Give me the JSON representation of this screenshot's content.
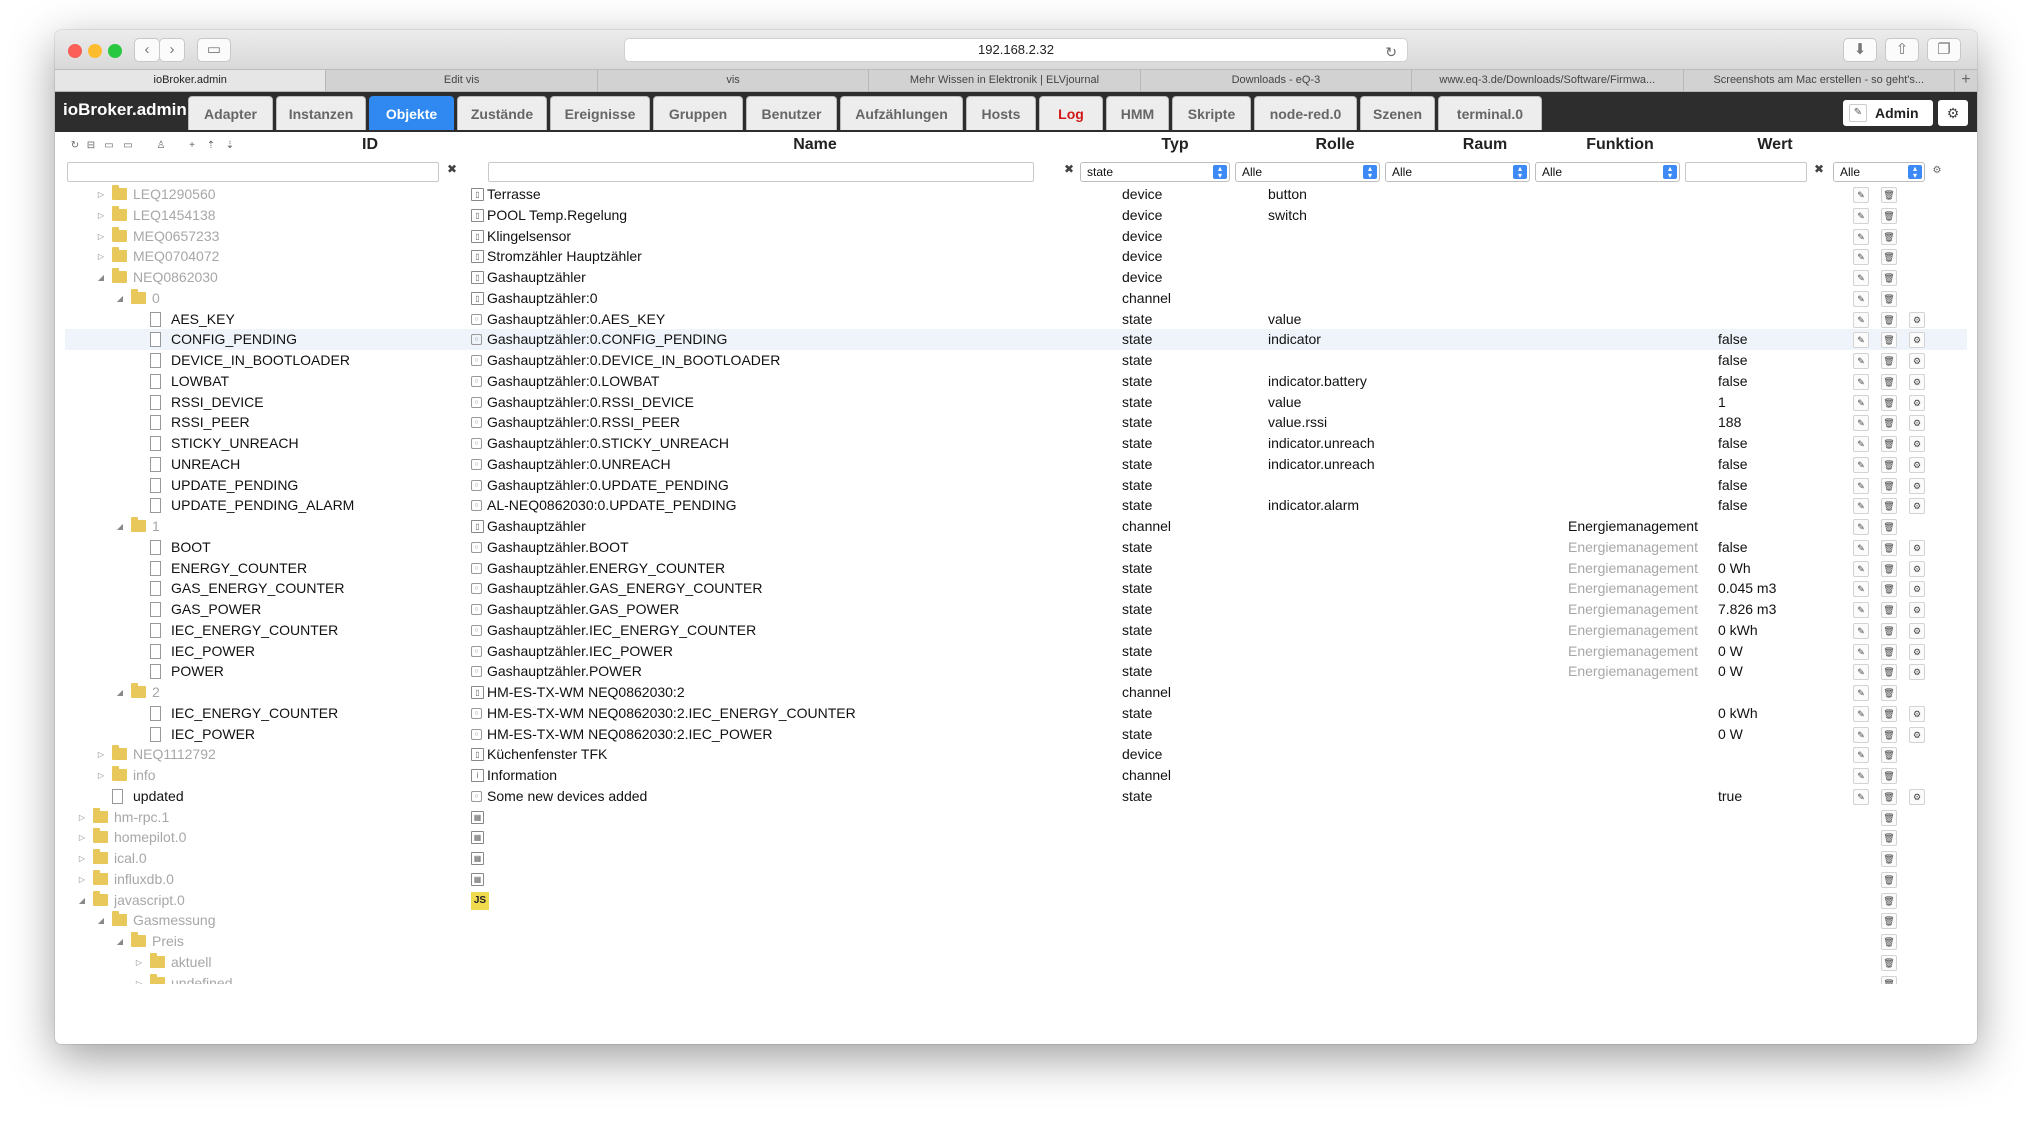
{
  "browser": {
    "address": "192.168.2.32",
    "tabs": [
      "ioBroker.admin",
      "Edit vis",
      "vis",
      "Mehr Wissen in Elektronik | ELVjournal",
      "Downloads - eQ-3",
      "www.eq-3.de/Downloads/Software/Firmwa...",
      "Screenshots am Mac erstellen - so geht's..."
    ]
  },
  "app": {
    "brand": "ioBroker.admin",
    "nav": [
      "Adapter",
      "Instanzen",
      "Objekte",
      "Zustände",
      "Ereignisse",
      "Gruppen",
      "Benutzer",
      "Aufzählungen",
      "Hosts",
      "Log",
      "HMM",
      "Skripte",
      "node-red.0",
      "Szenen",
      "terminal.0"
    ],
    "active_tab": "Objekte",
    "user": "Admin"
  },
  "table": {
    "headers": {
      "id": "ID",
      "name": "Name",
      "typ": "Typ",
      "rolle": "Rolle",
      "raum": "Raum",
      "funktion": "Funktion",
      "wert": "Wert"
    },
    "filters": {
      "typ": "state",
      "rolle": "Alle",
      "raum": "Alle",
      "funktion": "Alle",
      "last": "Alle"
    },
    "rows": [
      {
        "id": "LEQ1290560",
        "name": "Terrasse",
        "typ": "device",
        "rolle": "button",
        "funktion": "",
        "wert": ""
      },
      {
        "id": "LEQ1454138",
        "name": "POOL Temp.Regelung",
        "typ": "device",
        "rolle": "switch",
        "funktion": "",
        "wert": ""
      },
      {
        "id": "MEQ0657233",
        "name": "Klingelsensor",
        "typ": "device",
        "rolle": "",
        "funktion": "",
        "wert": ""
      },
      {
        "id": "MEQ0704072",
        "name": "Stromzähler Hauptzähler",
        "typ": "device",
        "rolle": "",
        "funktion": "",
        "wert": ""
      },
      {
        "id": "NEQ0862030",
        "name": "Gashauptzähler",
        "typ": "device",
        "rolle": "",
        "funktion": "",
        "wert": ""
      },
      {
        "id": "0",
        "name": "Gashauptzähler:0",
        "typ": "channel",
        "rolle": "",
        "funktion": "",
        "wert": ""
      },
      {
        "id": "AES_KEY",
        "name": "Gashauptzähler:0.AES_KEY",
        "typ": "state",
        "rolle": "value",
        "funktion": "",
        "wert": ""
      },
      {
        "id": "CONFIG_PENDING",
        "name": "Gashauptzähler:0.CONFIG_PENDING",
        "typ": "state",
        "rolle": "indicator",
        "funktion": "",
        "wert": "false"
      },
      {
        "id": "DEVICE_IN_BOOTLOADER",
        "name": "Gashauptzähler:0.DEVICE_IN_BOOTLOADER",
        "typ": "state",
        "rolle": "",
        "funktion": "",
        "wert": "false"
      },
      {
        "id": "LOWBAT",
        "name": "Gashauptzähler:0.LOWBAT",
        "typ": "state",
        "rolle": "indicator.battery",
        "funktion": "",
        "wert": "false"
      },
      {
        "id": "RSSI_DEVICE",
        "name": "Gashauptzähler:0.RSSI_DEVICE",
        "typ": "state",
        "rolle": "value",
        "funktion": "",
        "wert": "1"
      },
      {
        "id": "RSSI_PEER",
        "name": "Gashauptzähler:0.RSSI_PEER",
        "typ": "state",
        "rolle": "value.rssi",
        "funktion": "",
        "wert": "188"
      },
      {
        "id": "STICKY_UNREACH",
        "name": "Gashauptzähler:0.STICKY_UNREACH",
        "typ": "state",
        "rolle": "indicator.unreach",
        "funktion": "",
        "wert": "false"
      },
      {
        "id": "UNREACH",
        "name": "Gashauptzähler:0.UNREACH",
        "typ": "state",
        "rolle": "indicator.unreach",
        "funktion": "",
        "wert": "false"
      },
      {
        "id": "UPDATE_PENDING",
        "name": "Gashauptzähler:0.UPDATE_PENDING",
        "typ": "state",
        "rolle": "",
        "funktion": "",
        "wert": "false"
      },
      {
        "id": "UPDATE_PENDING_ALARM",
        "name": "AL-NEQ0862030:0.UPDATE_PENDING",
        "typ": "state",
        "rolle": "indicator.alarm",
        "funktion": "",
        "wert": "false"
      },
      {
        "id": "1",
        "name": "Gashauptzähler",
        "typ": "channel",
        "rolle": "",
        "funktion": "Energiemanagement",
        "wert": ""
      },
      {
        "id": "BOOT",
        "name": "Gashauptzähler.BOOT",
        "typ": "state",
        "rolle": "",
        "funktion": "Energiemanagement",
        "wert": "false"
      },
      {
        "id": "ENERGY_COUNTER",
        "name": "Gashauptzähler.ENERGY_COUNTER",
        "typ": "state",
        "rolle": "",
        "funktion": "Energiemanagement",
        "wert": "0 Wh"
      },
      {
        "id": "GAS_ENERGY_COUNTER",
        "name": "Gashauptzähler.GAS_ENERGY_COUNTER",
        "typ": "state",
        "rolle": "",
        "funktion": "Energiemanagement",
        "wert": "0.045 m3"
      },
      {
        "id": "GAS_POWER",
        "name": "Gashauptzähler.GAS_POWER",
        "typ": "state",
        "rolle": "",
        "funktion": "Energiemanagement",
        "wert": "7.826 m3"
      },
      {
        "id": "IEC_ENERGY_COUNTER",
        "name": "Gashauptzähler.IEC_ENERGY_COUNTER",
        "typ": "state",
        "rolle": "",
        "funktion": "Energiemanagement",
        "wert": "0 kWh"
      },
      {
        "id": "IEC_POWER",
        "name": "Gashauptzähler.IEC_POWER",
        "typ": "state",
        "rolle": "",
        "funktion": "Energiemanagement",
        "wert": "0 W"
      },
      {
        "id": "POWER",
        "name": "Gashauptzähler.POWER",
        "typ": "state",
        "rolle": "",
        "funktion": "Energiemanagement",
        "wert": "0 W"
      },
      {
        "id": "2",
        "name": "HM-ES-TX-WM NEQ0862030:2",
        "typ": "channel",
        "rolle": "",
        "funktion": "",
        "wert": ""
      },
      {
        "id": "IEC_ENERGY_COUNTER",
        "name": "HM-ES-TX-WM NEQ0862030:2.IEC_ENERGY_COUNTER",
        "typ": "state",
        "rolle": "",
        "funktion": "",
        "wert": "0 kWh"
      },
      {
        "id": "IEC_POWER",
        "name": "HM-ES-TX-WM NEQ0862030:2.IEC_POWER",
        "typ": "state",
        "rolle": "",
        "funktion": "",
        "wert": "0 W"
      },
      {
        "id": "NEQ1112792",
        "name": "Küchenfenster TFK",
        "typ": "device",
        "rolle": "",
        "funktion": "",
        "wert": ""
      },
      {
        "id": "info",
        "name": "Information",
        "typ": "channel",
        "rolle": "",
        "funktion": "",
        "wert": ""
      },
      {
        "id": "updated",
        "name": "Some new devices added",
        "typ": "state",
        "rolle": "",
        "funktion": "",
        "wert": "true"
      },
      {
        "id": "hm-rpc.1",
        "name": "",
        "typ": "",
        "rolle": "",
        "funktion": "",
        "wert": ""
      },
      {
        "id": "homepilot.0",
        "name": "",
        "typ": "",
        "rolle": "",
        "funktion": "",
        "wert": ""
      },
      {
        "id": "ical.0",
        "name": "",
        "typ": "",
        "rolle": "",
        "funktion": "",
        "wert": ""
      },
      {
        "id": "influxdb.0",
        "name": "",
        "typ": "",
        "rolle": "",
        "funktion": "",
        "wert": ""
      },
      {
        "id": "javascript.0",
        "name": "",
        "typ": "",
        "rolle": "",
        "funktion": "",
        "wert": ""
      },
      {
        "id": "Gasmessung",
        "name": "",
        "typ": "",
        "rolle": "",
        "funktion": "",
        "wert": ""
      },
      {
        "id": "Preis",
        "name": "",
        "typ": "",
        "rolle": "",
        "funktion": "",
        "wert": ""
      },
      {
        "id": "aktuell",
        "name": "",
        "typ": "",
        "rolle": "",
        "funktion": "",
        "wert": ""
      },
      {
        "id": "undefined",
        "name": "",
        "typ": "",
        "rolle": "",
        "funktion": "",
        "wert": ""
      }
    ]
  }
}
